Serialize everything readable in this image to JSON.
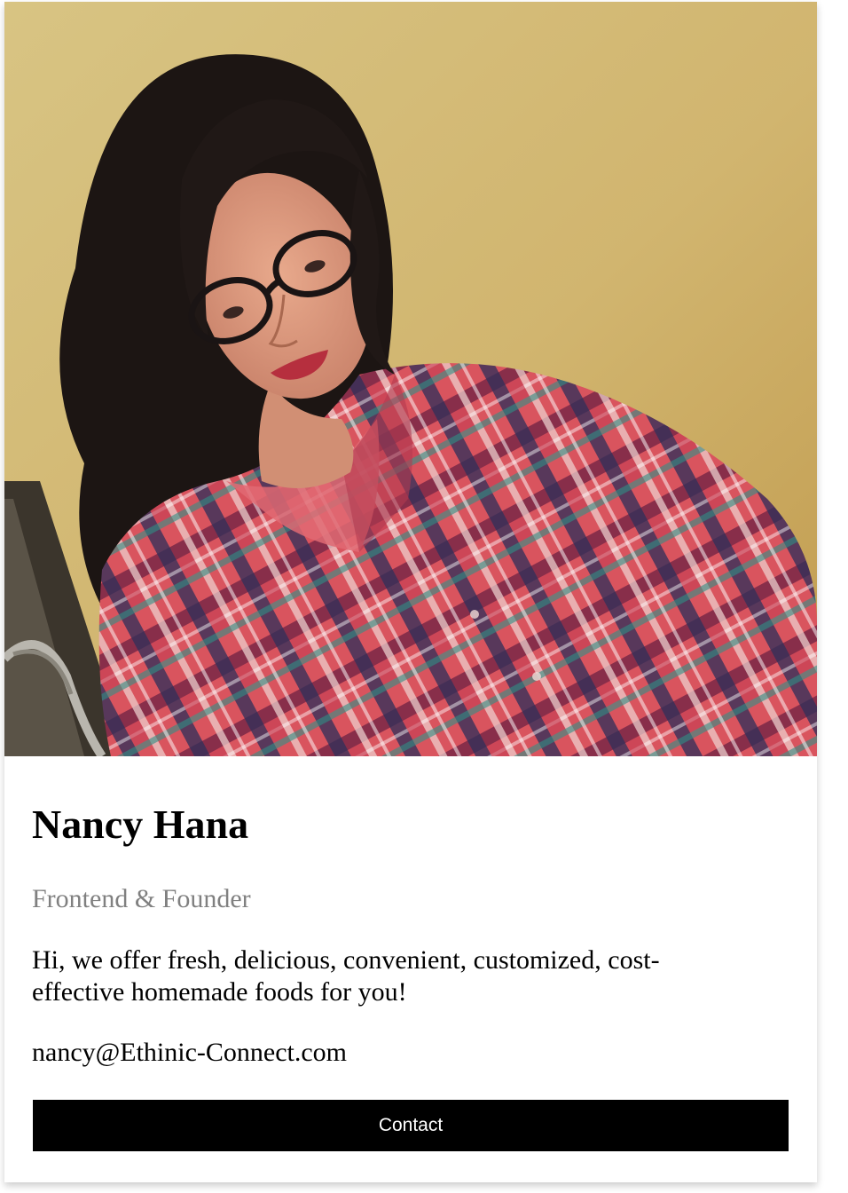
{
  "profile": {
    "name": "Nancy Hana",
    "title": "Frontend & Founder",
    "description": "Hi, we offer fresh, delicious, convenient, customized, cost-effective homemade foods for you!",
    "email": "nancy@Ethinic-Connect.com",
    "contact_label": "Contact"
  },
  "colors": {
    "button_background": "#000000",
    "button_text": "#ffffff",
    "title_text": "#808080",
    "photo_wall": "#d2b874"
  }
}
